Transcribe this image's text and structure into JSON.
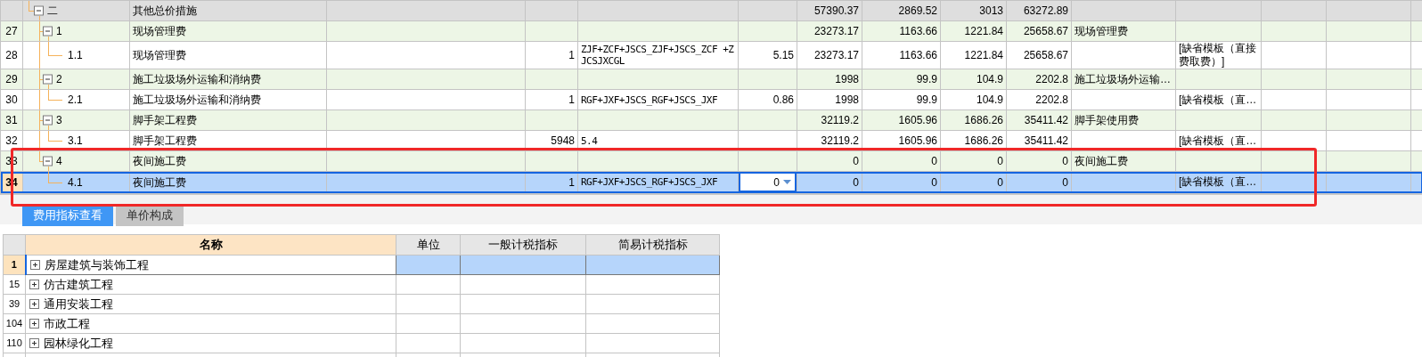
{
  "fee_table": {
    "rows": [
      {
        "code": "二",
        "name": "其他总价措施",
        "amount_1": "57390.37",
        "amount_2": "2869.52",
        "amount_3": "3013",
        "amount_4": "63272.89",
        "kind": "section",
        "expanded": true,
        "selected": false,
        "children": [
          {
            "num": "27",
            "code": "1",
            "name": "现场管理费",
            "amount_1": "23273.17",
            "amount_2": "1163.66",
            "amount_3": "1221.84",
            "amount_4": "25658.67",
            "remark": "现场管理费",
            "kind": "group",
            "expanded": true,
            "selected": false,
            "children": [
              {
                "num": "28",
                "code": "1.1",
                "name": "现场管理费",
                "col_5": "1",
                "formula": "ZJF+ZCF+JSCS_ZJF+JSCS_ZCF +ZJCSJXCGL",
                "rate": "5.15",
                "amount_1": "23273.17",
                "amount_2": "1163.66",
                "amount_3": "1221.84",
                "amount_4": "25658.67",
                "template": "[缺省模板（直接费取费）]",
                "kind": "item",
                "selected": false
              }
            ]
          },
          {
            "num": "29",
            "code": "2",
            "name": "施工垃圾场外运输和消纳费",
            "amount_1": "1998",
            "amount_2": "99.9",
            "amount_3": "104.9",
            "amount_4": "2202.8",
            "remark": "施工垃圾场外运输…",
            "kind": "group",
            "expanded": true,
            "selected": false,
            "children": [
              {
                "num": "30",
                "code": "2.1",
                "name": "施工垃圾场外运输和消纳费",
                "col_5": "1",
                "formula": "RGF+JXF+JSCS_RGF+JSCS_JXF",
                "rate": "0.86",
                "amount_1": "1998",
                "amount_2": "99.9",
                "amount_3": "104.9",
                "amount_4": "2202.8",
                "template": "[缺省模板（直…",
                "kind": "item",
                "selected": false
              }
            ]
          },
          {
            "num": "31",
            "code": "3",
            "name": "脚手架工程费",
            "amount_1": "32119.2",
            "amount_2": "1605.96",
            "amount_3": "1686.26",
            "amount_4": "35411.42",
            "remark": "脚手架使用费",
            "kind": "group",
            "expanded": true,
            "selected": false,
            "children": [
              {
                "num": "32",
                "code": "3.1",
                "name": "脚手架工程费",
                "col_5": "5948",
                "formula": "5.4",
                "amount_1": "32119.2",
                "amount_2": "1605.96",
                "amount_3": "1686.26",
                "amount_4": "35411.42",
                "template": "[缺省模板（直…",
                "kind": "item",
                "selected": false
              }
            ]
          },
          {
            "num": "33",
            "code": "4",
            "name": "夜间施工费",
            "amount_1": "0",
            "amount_2": "0",
            "amount_3": "0",
            "amount_4": "0",
            "remark": "夜间施工费",
            "kind": "group",
            "expanded": true,
            "selected": false,
            "children": [
              {
                "num": "34",
                "code": "4.1",
                "name": "夜间施工费",
                "col_5": "1",
                "formula": "RGF+JXF+JSCS_RGF+JSCS_JXF",
                "rate": "0",
                "rate_editing": true,
                "amount_1": "0",
                "amount_2": "0",
                "amount_3": "0",
                "amount_4": "0",
                "template": "[缺省模板（直…",
                "kind": "item",
                "selected": true
              }
            ]
          }
        ]
      }
    ]
  },
  "tabs": [
    {
      "label": "费用指标查看",
      "selected": true
    },
    {
      "label": "单价构成",
      "selected": false
    }
  ],
  "index_table": {
    "columns": [
      "名称",
      "单位",
      "一般计税指标",
      "简易计税指标"
    ],
    "rows": [
      {
        "num": "1",
        "name": "房屋建筑与装饰工程",
        "expanded": false,
        "selected": true
      },
      {
        "num": "15",
        "name": "仿古建筑工程",
        "expanded": false,
        "selected": false
      },
      {
        "num": "39",
        "name": "通用安装工程",
        "expanded": false,
        "selected": false
      },
      {
        "num": "104",
        "name": "市政工程",
        "expanded": false,
        "selected": false
      },
      {
        "num": "110",
        "name": "园林绿化工程",
        "expanded": false,
        "selected": false
      }
    ]
  }
}
